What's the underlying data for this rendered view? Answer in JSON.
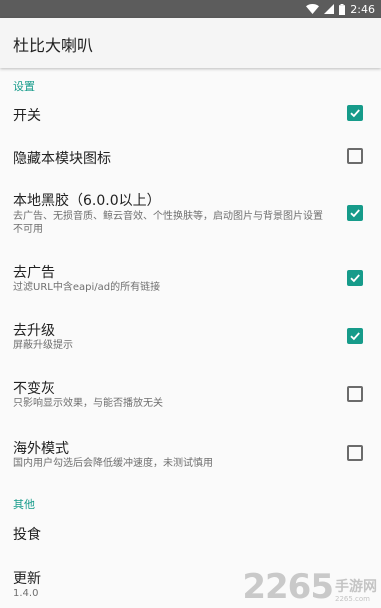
{
  "status_bar": {
    "time": "2:46"
  },
  "app_bar": {
    "title": "杜比大喇叭"
  },
  "sections": {
    "settings_header": "设置",
    "other_header": "其他"
  },
  "prefs": {
    "switch": {
      "title": "开关",
      "checked": true
    },
    "hide_icon": {
      "title": "隐藏本模块图标",
      "checked": false
    },
    "local_vinyl": {
      "title": "本地黑胶（6.0.0以上）",
      "summary": "去广告、无损音质、鲸云音效、个性换肤等，启动图片与背景图片设置不可用",
      "checked": true
    },
    "remove_ads": {
      "title": "去广告",
      "summary": "过滤URL中含eapi/ad的所有链接",
      "checked": true
    },
    "no_upgrade": {
      "title": "去升级",
      "summary": "屏蔽升级提示",
      "checked": true
    },
    "no_gray": {
      "title": "不变灰",
      "summary": "只影响显示效果，与能否播放无关",
      "checked": false
    },
    "overseas": {
      "title": "海外模式",
      "summary": "国内用户勾选后会降低缓冲速度，未测试慎用",
      "checked": false
    },
    "donate": {
      "title": "投食"
    },
    "update": {
      "title": "更新",
      "summary": "1.4.0"
    }
  },
  "watermark": {
    "number": "2265",
    "cn": "手游网",
    "url": "2265.com"
  },
  "colors": {
    "accent": "#169b8a",
    "status_bar": "#5c5c5c",
    "background": "#fafafa"
  }
}
